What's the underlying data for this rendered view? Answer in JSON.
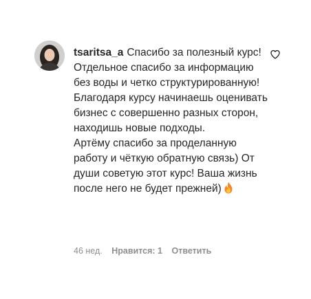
{
  "comment": {
    "username": "tsaritsa_a",
    "text_lines": [
      "Спасибо за полезный курс! Отдельное спасибо за информацию без воды и четко структурированную! Благодаря курсу начинаешь оценивать бизнес с совершенно разных сторон, находишь новые подходы.",
      "Артёму спасибо за проделанную работу и чёткую обратную связь) От души советую этот курс! Ваша жизнь после него не будет прежней)"
    ],
    "emoji": "fire-emoji"
  },
  "meta": {
    "time": "46 нед.",
    "likes": "Нравится: 1",
    "reply": "Ответить"
  },
  "icons": {
    "like": "heart-outline-icon",
    "avatar": "user-avatar"
  }
}
